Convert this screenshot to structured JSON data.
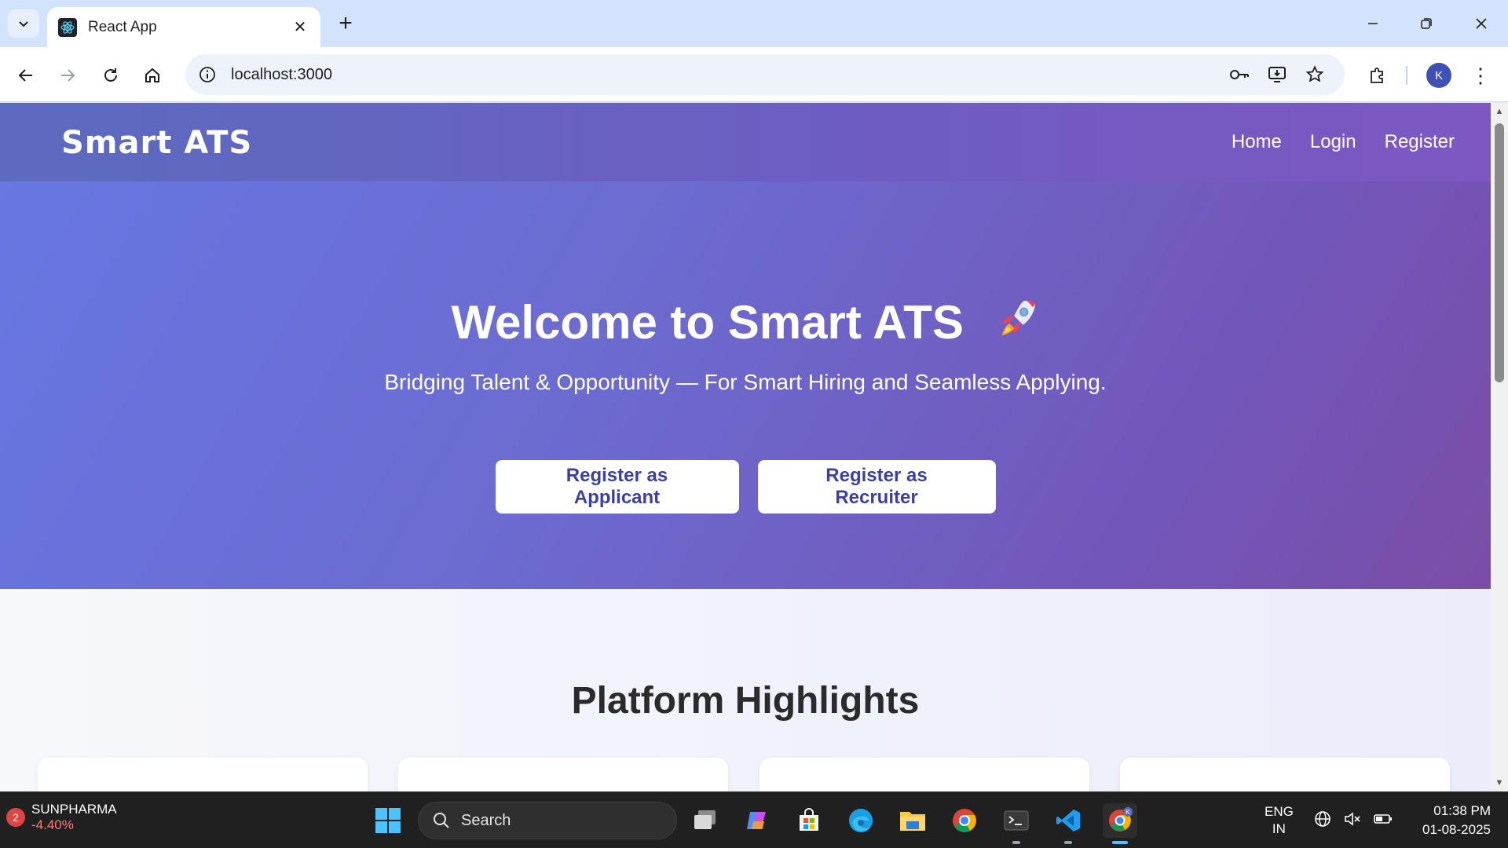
{
  "browser": {
    "tab_title": "React App",
    "url": "localhost:3000",
    "profile_initial": "K"
  },
  "site": {
    "brand": "Smart ATS",
    "nav_links": [
      "Home",
      "Login",
      "Register"
    ],
    "hero": {
      "title": "Welcome to Smart ATS",
      "subtitle": "Bridging Talent & Opportunity — For Smart Hiring and Seamless Applying.",
      "buttons": [
        "Register as Applicant",
        "Register as Recruiter"
      ]
    },
    "highlights_title": "Platform Highlights"
  },
  "taskbar": {
    "stock_badge": "2",
    "stock_name": "SUNPHARMA",
    "stock_change": "-4.40%",
    "search_placeholder": "Search",
    "lang_primary": "ENG",
    "lang_secondary": "IN",
    "time": "01:38 PM",
    "date": "01-08-2025"
  },
  "colors": {
    "nav_gradient": [
      "#5c6bc0",
      "#7e57c2"
    ],
    "hero_gradient": [
      "#6777e3",
      "#7a4ea6"
    ],
    "button_text": "#3b3fa6",
    "tab_strip": "#d3e3fd"
  }
}
